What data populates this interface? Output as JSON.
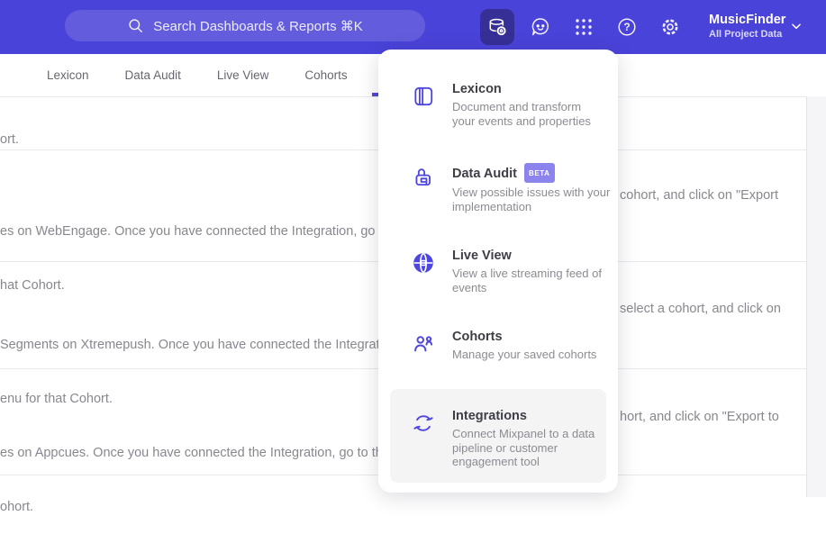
{
  "header": {
    "search_placeholder": "Search Dashboards & Reports ⌘K",
    "project_name": "MusicFinder",
    "project_scope": "All Project Data",
    "colors": {
      "bar": "#4a43d9",
      "active_icon_bg": "#362f96",
      "accent": "#4f46e0"
    }
  },
  "nav": {
    "tabs": [
      {
        "label": "Lexicon"
      },
      {
        "label": "Data Audit"
      },
      {
        "label": "Live View"
      },
      {
        "label": "Cohorts"
      }
    ]
  },
  "menu": {
    "items": [
      {
        "title": "Lexicon",
        "icon": "lexicon-book-icon",
        "desc_lines": [
          "Document and transform",
          "your events and properties"
        ]
      },
      {
        "title": "Data Audit",
        "badge": "BETA",
        "icon": "data-audit-lock-icon",
        "desc_lines": [
          "View possible issues with your",
          "implementation"
        ]
      },
      {
        "title": "Live View",
        "icon": "live-view-globe-icon",
        "desc_lines": [
          "View a live streaming feed of",
          "events"
        ]
      },
      {
        "title": "Cohorts",
        "icon": "cohorts-people-icon",
        "desc_lines": [
          "Manage your saved cohorts"
        ]
      },
      {
        "title": "Integrations",
        "icon": "integrations-sync-icon",
        "desc_lines": [
          "Connect Mixpanel to a data",
          "pipeline or customer",
          "engagement tool"
        ]
      }
    ]
  },
  "content": {
    "rows": [
      {
        "left_lines": [
          "ort."
        ],
        "right_line": ""
      },
      {
        "left_lines": [
          "es on WebEngage. Once you have connected the Integration, go to the",
          "hat Cohort."
        ],
        "right_line": "cohort, and click on \"Export"
      },
      {
        "left_lines": [
          "Segments on Xtremepush. Once you have connected the Integration,",
          "enu for that Cohort."
        ],
        "right_line": "select a cohort, and click on"
      },
      {
        "left_lines": [
          "es on Appcues. Once you have connected the Integration, go to the M",
          "ohort."
        ],
        "right_line": "hort, and click on \"Export to"
      }
    ]
  }
}
